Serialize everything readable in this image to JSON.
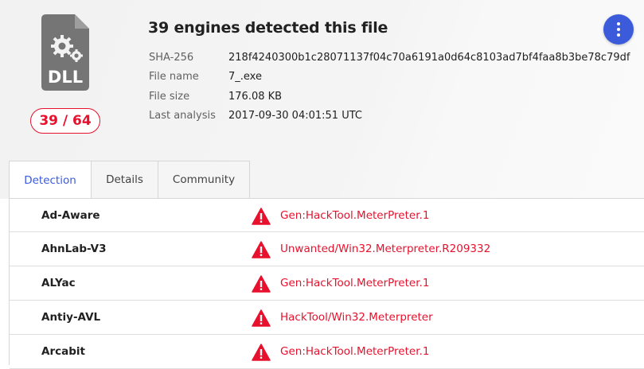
{
  "file": {
    "type_label": "DLL",
    "score": "39 / 64",
    "title": "39 engines detected this file",
    "details": [
      {
        "key": "SHA-256",
        "value": "218f4240300b1c28071137f04c70a6191a0d64c8103ad7bf4faa8b3be78c79df"
      },
      {
        "key": "File name",
        "value": "7_.exe"
      },
      {
        "key": "File size",
        "value": "176.08 KB"
      },
      {
        "key": "Last analysis",
        "value": "2017-09-30 04:01:51 UTC"
      }
    ]
  },
  "tabs": [
    {
      "label": "Detection",
      "active": true
    },
    {
      "label": "Details",
      "active": false
    },
    {
      "label": "Community",
      "active": false
    }
  ],
  "detections": [
    {
      "engine": "Ad-Aware",
      "result": "Gen:HackTool.MeterPreter.1"
    },
    {
      "engine": "AhnLab-V3",
      "result": "Unwanted/Win32.Meterpreter.R209332"
    },
    {
      "engine": "ALYac",
      "result": "Gen:HackTool.MeterPreter.1"
    },
    {
      "engine": "Antiy-AVL",
      "result": "HackTool/Win32.Meterpreter"
    },
    {
      "engine": "Arcabit",
      "result": "Gen:HackTool.MeterPreter.1"
    }
  ],
  "colors": {
    "malicious": "#e8112d",
    "accent": "#3b5bdb",
    "icon": "#757575"
  }
}
